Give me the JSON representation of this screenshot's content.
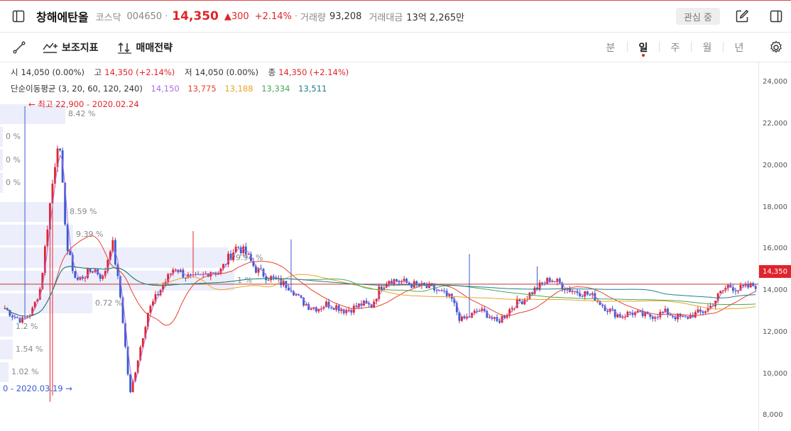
{
  "header": {
    "stock_name": "창해에탄올",
    "market": "코스닥",
    "code": "004650",
    "separator": "·",
    "price": "14,350",
    "change": "▲300",
    "change_pct": "+2.14%",
    "volume_label": "거래량",
    "volume": "93,208",
    "amount_label": "거래대금",
    "amount": "13억 2,265만",
    "favorite_label": "관심 중"
  },
  "toolbar": {
    "indicator_label": "보조지표",
    "strategy_label": "매매전략",
    "timeframes": [
      "분",
      "일",
      "주",
      "월",
      "년"
    ],
    "active_timeframe": "일"
  },
  "legend": {
    "open_label": "시",
    "open": "14,050 (0.00%)",
    "high_label": "고",
    "high": "14,350 (+2.14%)",
    "low_label": "저",
    "low": "14,050 (0.00%)",
    "close_label": "종",
    "close": "14,350 (+2.14%)",
    "ma_label": "단순이동평균 (3, 20, 60, 120, 240)",
    "ma": [
      {
        "value": "14,150",
        "color": "#b06ee6"
      },
      {
        "value": "13,775",
        "color": "#e8412f"
      },
      {
        "value": "13,188",
        "color": "#e8a42a"
      },
      {
        "value": "13,334",
        "color": "#4aa657"
      },
      {
        "value": "13,511",
        "color": "#1f7f8a"
      }
    ]
  },
  "chart_data": {
    "type": "candlestick",
    "y_ticks": [
      "24,000",
      "22,000",
      "20,000",
      "18,000",
      "16,000",
      "14,000",
      "12,000",
      "10,000",
      "8,000"
    ],
    "ylim": [
      7300,
      25000
    ],
    "current_price": 14350,
    "current_price_label": "14,350",
    "high_marker": {
      "text": "← 최고 22,900 - 2020.02.24",
      "value": 22900
    },
    "low_marker": {
      "text": "0 - 2020.03.19 →",
      "value": 8700
    },
    "volume_profile": [
      {
        "price": 22500,
        "pct": "8.42 %",
        "width": 92
      },
      {
        "price": 21400,
        "pct": "0 %",
        "width": 4
      },
      {
        "price": 20300,
        "pct": "0 %",
        "width": 4
      },
      {
        "price": 19200,
        "pct": "0 %",
        "width": 4
      },
      {
        "price": 17800,
        "pct": "8.59 %",
        "width": 94
      },
      {
        "price": 16700,
        "pct": "9.39 %",
        "width": 103
      },
      {
        "price": 15600,
        "pct": "29.94 %",
        "width": 321
      },
      {
        "price": 14500,
        "pct": "1 %",
        "width": 330
      },
      {
        "price": 13400,
        "pct": "0.72 %",
        "width": 130
      },
      {
        "price": 12300,
        "pct": "1.2 %",
        "width": 18
      },
      {
        "price": 11200,
        "pct": "1.54 %",
        "width": 18
      },
      {
        "price": 10100,
        "pct": "1.02 %",
        "width": 12
      }
    ],
    "close_path": [
      13200,
      12800,
      12600,
      13000,
      14200,
      18000,
      21500,
      16000,
      14500,
      14800,
      15100,
      14600,
      16500,
      13500,
      9000,
      11000,
      13000,
      13800,
      14500,
      15200,
      14800,
      14600,
      14700,
      15000,
      14900,
      15600,
      16200,
      15800,
      15100,
      14800,
      14600,
      14400,
      14200,
      13600,
      13300,
      13200,
      13400,
      13300,
      13100,
      13200,
      13400,
      13300,
      14200,
      14600,
      14500,
      14400,
      14300,
      14200,
      14100,
      13900,
      13600,
      12600,
      12800,
      13100,
      12900,
      12500,
      12900,
      13400,
      13600,
      14000,
      14300,
      14600,
      14400,
      14100,
      14000,
      13900,
      13700,
      13300,
      13000,
      12800,
      13000,
      12900,
      12800,
      12900,
      13000,
      12800,
      12700,
      12900,
      13000,
      13300,
      13900,
      14300,
      14100,
      14200,
      14300
    ]
  }
}
